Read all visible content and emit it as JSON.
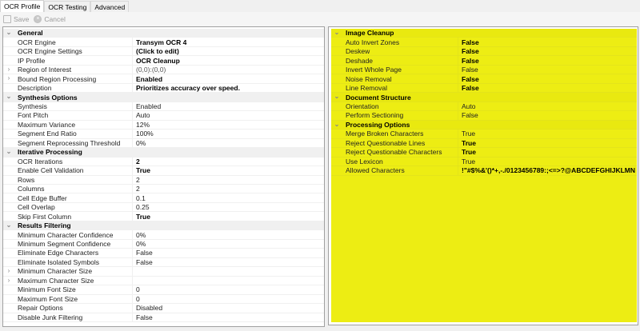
{
  "tabs": [
    "OCR Profile",
    "OCR Testing",
    "Advanced"
  ],
  "active_tab": 0,
  "toolbar": {
    "save_label": "Save",
    "cancel_label": "Cancel",
    "save_icon": "save-icon",
    "cancel_icon": "cancel-icon"
  },
  "left_grid": [
    {
      "category": "General",
      "items": [
        {
          "name": "OCR Engine",
          "value": "Transym OCR 4",
          "bold": true
        },
        {
          "name": "OCR Engine Settings",
          "value": "(Click to edit)",
          "bold": true
        },
        {
          "name": "IP Profile",
          "value": "OCR Cleanup",
          "bold": true
        },
        {
          "name": "Region of Interest",
          "value": "(0,0):(0,0)",
          "expandable": true,
          "gray": true
        },
        {
          "name": "Bound Region Processing",
          "value": "Enabled",
          "bold": true,
          "expandable": true
        },
        {
          "name": "Description",
          "value": "Prioritizes accuracy over speed.",
          "bold": true
        }
      ]
    },
    {
      "category": "Synthesis Options",
      "items": [
        {
          "name": "Synthesis",
          "value": "Enabled"
        },
        {
          "name": "Font Pitch",
          "value": "Auto"
        },
        {
          "name": "Maximum Variance",
          "value": "12%"
        },
        {
          "name": "Segment End Ratio",
          "value": "100%"
        },
        {
          "name": "Segment Reprocessing Threshold",
          "value": "0%"
        }
      ]
    },
    {
      "category": "Iterative Processing",
      "items": [
        {
          "name": "OCR Iterations",
          "value": "2",
          "bold": true
        },
        {
          "name": "Enable Cell Validation",
          "value": "True",
          "bold": true
        },
        {
          "name": "Rows",
          "value": "2"
        },
        {
          "name": "Columns",
          "value": "2"
        },
        {
          "name": "Cell Edge Buffer",
          "value": "0.1"
        },
        {
          "name": "Cell Overlap",
          "value": "0.25"
        },
        {
          "name": "Skip First Column",
          "value": "True",
          "bold": true
        }
      ]
    },
    {
      "category": "Results Filtering",
      "items": [
        {
          "name": "Minimum Character Confidence",
          "value": "0%"
        },
        {
          "name": "Minimum Segment Confidence",
          "value": "0%"
        },
        {
          "name": "Eliminate Edge Characters",
          "value": "False"
        },
        {
          "name": "Eliminate Isolated Symbols",
          "value": "False"
        },
        {
          "name": "Minimum Character Size",
          "value": "",
          "expandable": true
        },
        {
          "name": "Maximum Character Size",
          "value": "",
          "expandable": true
        },
        {
          "name": "Minimum Font Size",
          "value": "0"
        },
        {
          "name": "Maximum Font Size",
          "value": "0"
        },
        {
          "name": "Repair Options",
          "value": "Disabled"
        },
        {
          "name": "Disable Junk Filtering",
          "value": "False"
        }
      ]
    }
  ],
  "right_grid": [
    {
      "category": "Image Cleanup",
      "items": [
        {
          "name": "Auto Invert Zones",
          "value": "False",
          "bold": true
        },
        {
          "name": "Deskew",
          "value": "False",
          "bold": true
        },
        {
          "name": "Deshade",
          "value": "False",
          "bold": true
        },
        {
          "name": "Invert Whole Page",
          "value": "False"
        },
        {
          "name": "Noise Removal",
          "value": "False",
          "bold": true
        },
        {
          "name": "Line Removal",
          "value": "False",
          "bold": true
        }
      ]
    },
    {
      "category": "Document Structure",
      "items": [
        {
          "name": "Orientation",
          "value": "Auto"
        },
        {
          "name": "Perform Sectioning",
          "value": "False"
        }
      ]
    },
    {
      "category": "Processing Options",
      "items": [
        {
          "name": "Merge Broken Characters",
          "value": "True"
        },
        {
          "name": "Reject Questionable Lines",
          "value": "True",
          "bold": true
        },
        {
          "name": "Reject Questionable Characters",
          "value": "True",
          "bold": true
        },
        {
          "name": "Use Lexicon",
          "value": "True"
        },
        {
          "name": "Allowed Characters",
          "value": "!\"#$%&'()*+,-./0123456789:;<=>?@ABCDEFGHIJKLMN",
          "bold": true
        }
      ]
    }
  ],
  "colors": {
    "highlight": "#eded13"
  }
}
